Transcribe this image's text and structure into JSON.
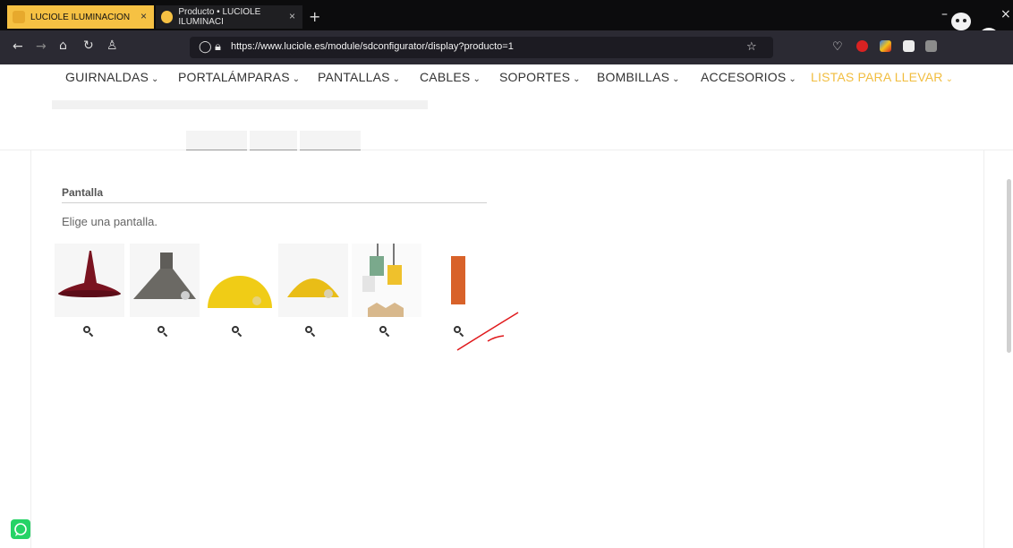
{
  "browser": {
    "tabs": [
      {
        "title": "LUCIOLE ILUMINACION",
        "close": "×"
      },
      {
        "title": "Producto • LUCIOLE ILUMINACI",
        "close": "×"
      }
    ],
    "new_tab": "+",
    "url": "https://www.luciole.es/module/sdconfigurator/display?producto=1",
    "window_controls": [
      "–",
      "×"
    ]
  },
  "nav": {
    "items": [
      {
        "label": "GUIRNALDAS",
        "accent": false
      },
      {
        "label": "PORTALÁMPARAS",
        "accent": false
      },
      {
        "label": "PANTALLAS",
        "accent": false
      },
      {
        "label": "CABLES",
        "accent": false
      },
      {
        "label": "SOPORTES",
        "accent": false
      },
      {
        "label": "BOMBILLAS",
        "accent": false
      },
      {
        "label": "ACCESORIOS",
        "accent": false
      },
      {
        "label": "LISTAS PARA LLEVAR",
        "accent": true
      }
    ],
    "chevron": "⌄"
  },
  "section": {
    "title": "Pantalla",
    "description": "Elige una pantalla."
  },
  "products": [
    {
      "name": "red-cone-shade",
      "color": "#7a1320"
    },
    {
      "name": "grey-concrete-shade",
      "color": "#6b6964"
    },
    {
      "name": "yellow-dome-shade",
      "color": "#f0cc16"
    },
    {
      "name": "yellow-disc-shade",
      "color": "#e9bd17"
    },
    {
      "name": "pendant-photo-shade",
      "color": "#7aa98c"
    },
    {
      "name": "orange-cylinder-shade",
      "color": "#d8622a"
    }
  ],
  "colors": {
    "accent": "#f1bd3f",
    "annotation": "#e0191c",
    "whatsapp": "#25d366"
  },
  "icons": {
    "zoom": "search-icon",
    "whatsapp": "whatsapp-icon"
  }
}
